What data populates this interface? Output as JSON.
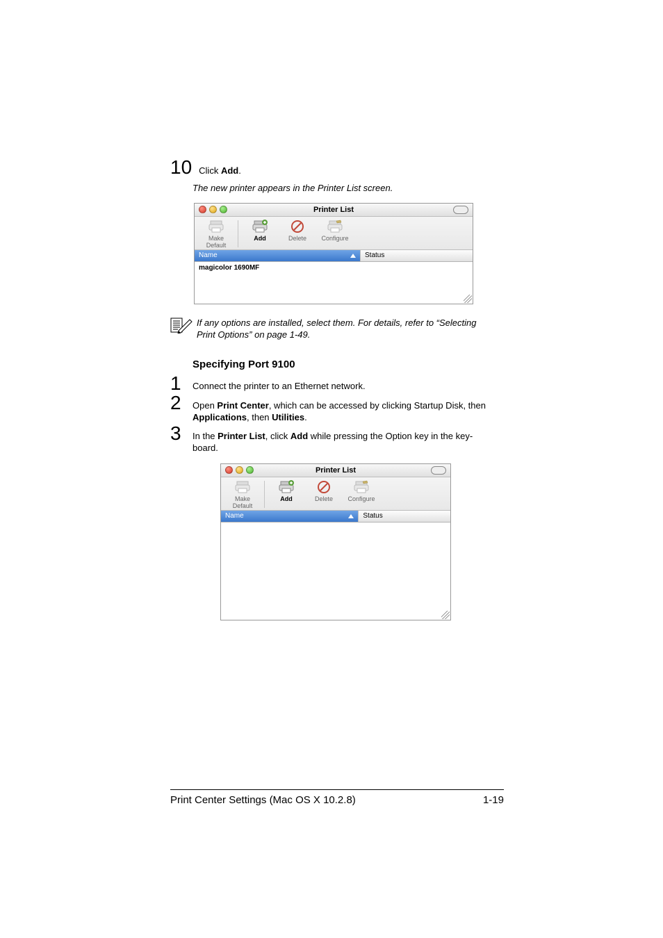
{
  "step10": {
    "number": "10",
    "prefix": "Click ",
    "bold": "Add",
    "suffix": ".",
    "italic_line": "The new printer appears in the Printer List screen."
  },
  "window1": {
    "title": "Printer List",
    "toolbar": {
      "make_default": "Make Default",
      "add": "Add",
      "delete": "Delete",
      "configure": "Configure"
    },
    "columns": {
      "name": "Name",
      "status": "Status"
    },
    "row1": "magicolor 1690MF"
  },
  "note": {
    "text_a": "If any options are installed, select them. For details, refer to “Selecting ",
    "text_b": "Print Options” on page 1-49."
  },
  "h3": "Specifying Port 9100",
  "steps": {
    "s1": {
      "n": "1",
      "text": "Connect the printer to an Ethernet network."
    },
    "s2": {
      "n": "2",
      "a": "Open ",
      "b": "Print Center",
      "c": ", which can be accessed by clicking Startup Disk, then ",
      "d": "Applications",
      "e": ", then ",
      "f": "Utilities",
      "g": "."
    },
    "s3": {
      "n": "3",
      "a": "In the ",
      "b": "Printer List",
      "c": ", click ",
      "d": "Add",
      "e": " while pressing the Option key in the key",
      "f": "board."
    }
  },
  "window2": {
    "title": "Printer List",
    "toolbar": {
      "make_default": "Make Default",
      "add": "Add",
      "delete": "Delete",
      "configure": "Configure"
    },
    "columns": {
      "name": "Name",
      "status": "Status"
    }
  },
  "footer": {
    "left": "Print Center Settings (Mac OS X 10.2.8)",
    "right": "1-19"
  }
}
